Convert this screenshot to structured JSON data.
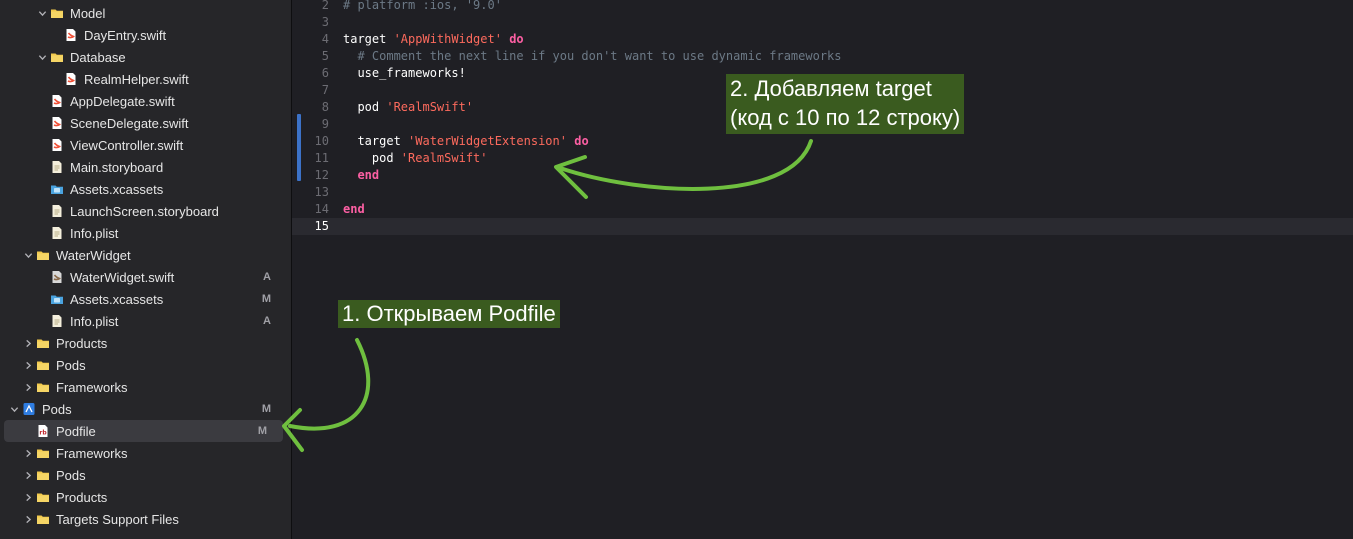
{
  "navigator": {
    "items": [
      {
        "label": "Model",
        "type": "folder",
        "indent": 2,
        "expanded": true,
        "status": ""
      },
      {
        "label": "DayEntry.swift",
        "type": "swift",
        "indent": 3,
        "status": ""
      },
      {
        "label": "Database",
        "type": "folder",
        "indent": 2,
        "expanded": true,
        "status": ""
      },
      {
        "label": "RealmHelper.swift",
        "type": "swift",
        "indent": 3,
        "status": ""
      },
      {
        "label": "AppDelegate.swift",
        "type": "swift",
        "indent": 2,
        "status": ""
      },
      {
        "label": "SceneDelegate.swift",
        "type": "swift",
        "indent": 2,
        "status": ""
      },
      {
        "label": "ViewController.swift",
        "type": "swift",
        "indent": 2,
        "status": ""
      },
      {
        "label": "Main.storyboard",
        "type": "doc",
        "indent": 2,
        "status": ""
      },
      {
        "label": "Assets.xcassets",
        "type": "assets",
        "indent": 2,
        "status": ""
      },
      {
        "label": "LaunchScreen.storyboard",
        "type": "doc",
        "indent": 2,
        "status": ""
      },
      {
        "label": "Info.plist",
        "type": "doc",
        "indent": 2,
        "status": ""
      },
      {
        "label": "WaterWidget",
        "type": "folder",
        "indent": 1,
        "expanded": true,
        "status": ""
      },
      {
        "label": "WaterWidget.swift",
        "type": "swift-gray",
        "indent": 2,
        "status": "A"
      },
      {
        "label": "Assets.xcassets",
        "type": "assets",
        "indent": 2,
        "status": "M"
      },
      {
        "label": "Info.plist",
        "type": "doc",
        "indent": 2,
        "status": "A"
      },
      {
        "label": "Products",
        "type": "folder",
        "indent": 1,
        "expanded": false,
        "status": ""
      },
      {
        "label": "Pods",
        "type": "folder",
        "indent": 1,
        "expanded": false,
        "status": ""
      },
      {
        "label": "Frameworks",
        "type": "folder",
        "indent": 1,
        "expanded": false,
        "status": ""
      },
      {
        "label": "Pods",
        "type": "project",
        "indent": 0,
        "expanded": true,
        "status": "M"
      },
      {
        "label": "Podfile",
        "type": "rb",
        "indent": 1,
        "status": "M",
        "selected": true
      },
      {
        "label": "Frameworks",
        "type": "folder",
        "indent": 1,
        "expanded": false,
        "status": ""
      },
      {
        "label": "Pods",
        "type": "folder",
        "indent": 1,
        "expanded": false,
        "status": ""
      },
      {
        "label": "Products",
        "type": "folder",
        "indent": 1,
        "expanded": false,
        "status": ""
      },
      {
        "label": "Targets Support Files",
        "type": "folder",
        "indent": 1,
        "expanded": false,
        "status": ""
      }
    ]
  },
  "editor": {
    "current_line": 15,
    "lines": [
      {
        "n": "2",
        "tokens": [
          {
            "t": "# platform :ios, '9.0'",
            "c": "cmt"
          }
        ]
      },
      {
        "n": "3",
        "tokens": []
      },
      {
        "n": "4",
        "tokens": [
          {
            "t": "target ",
            "c": "plain"
          },
          {
            "t": "'AppWithWidget'",
            "c": "str"
          },
          {
            "t": " ",
            "c": "plain"
          },
          {
            "t": "do",
            "c": "kw"
          }
        ]
      },
      {
        "n": "5",
        "tokens": [
          {
            "t": "  # Comment the next line if you don't want to use dynamic frameworks",
            "c": "cmt"
          }
        ]
      },
      {
        "n": "6",
        "tokens": [
          {
            "t": "  use_frameworks!",
            "c": "plain"
          }
        ]
      },
      {
        "n": "7",
        "tokens": []
      },
      {
        "n": "8",
        "tokens": [
          {
            "t": "  pod ",
            "c": "plain"
          },
          {
            "t": "'RealmSwift'",
            "c": "str"
          }
        ]
      },
      {
        "n": "9",
        "tokens": []
      },
      {
        "n": "10",
        "tokens": [
          {
            "t": "  target ",
            "c": "plain"
          },
          {
            "t": "'WaterWidgetExtension'",
            "c": "str"
          },
          {
            "t": " ",
            "c": "plain"
          },
          {
            "t": "do",
            "c": "kw"
          }
        ]
      },
      {
        "n": "11",
        "tokens": [
          {
            "t": "    pod ",
            "c": "plain"
          },
          {
            "t": "'RealmSwift'",
            "c": "str"
          }
        ]
      },
      {
        "n": "12",
        "tokens": [
          {
            "t": "  ",
            "c": "plain"
          },
          {
            "t": "end",
            "c": "kw"
          }
        ]
      },
      {
        "n": "13",
        "tokens": []
      },
      {
        "n": "14",
        "tokens": [
          {
            "t": "end",
            "c": "kw"
          }
        ]
      },
      {
        "n": "15",
        "tokens": []
      }
    ]
  },
  "annotations": {
    "step1": "1. Открываем Podfile",
    "step2_line1": "2. Добавляем target",
    "step2_line2": "(код с 10 по 12 строку)",
    "box_color": "#3a5b1f",
    "arrow_color": "#6fbf3f"
  }
}
